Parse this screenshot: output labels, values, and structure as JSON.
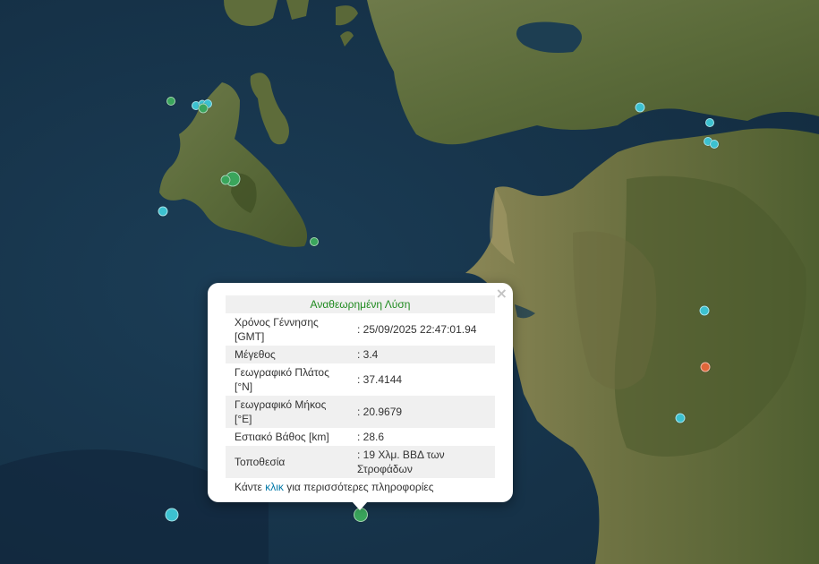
{
  "map": {
    "markers": [
      {
        "id": "m1",
        "color": "#3aa55c",
        "size": 10
      },
      {
        "id": "m2",
        "color": "#3cc1d0",
        "size": 10
      },
      {
        "id": "m3",
        "color": "#3cc1d0",
        "size": 9
      },
      {
        "id": "m4",
        "color": "#3cc1d0",
        "size": 10
      },
      {
        "id": "m5",
        "color": "#3aa55c",
        "size": 11
      },
      {
        "id": "m6",
        "color": "#3aa55c",
        "size": 17
      },
      {
        "id": "m7",
        "color": "#3aa55c",
        "size": 11
      },
      {
        "id": "m8",
        "color": "#3cc1d0",
        "size": 11
      },
      {
        "id": "m9",
        "color": "#3aa55c",
        "size": 10
      },
      {
        "id": "m10",
        "color": "#3cc1d0",
        "size": 11
      },
      {
        "id": "m11",
        "color": "#3cc1d0",
        "size": 10
      },
      {
        "id": "m12",
        "color": "#3cc1d0",
        "size": 10
      },
      {
        "id": "m13",
        "color": "#3cc1d0",
        "size": 10
      },
      {
        "id": "m14",
        "color": "#3cc1d0",
        "size": 11
      },
      {
        "id": "m15",
        "color": "#e0663a",
        "size": 11
      },
      {
        "id": "m16",
        "color": "#3cc1d0",
        "size": 11
      },
      {
        "id": "m17",
        "color": "#3cc1d0",
        "size": 15
      },
      {
        "id": "m18",
        "color": "#3aa55c",
        "size": 16
      }
    ]
  },
  "popup": {
    "close_symbol": "×",
    "title": "Αναθεωρημένη Λύση",
    "rows": [
      {
        "label": "Χρόνος Γέννησης [GMT]",
        "value": ": 25/09/2025 22:47:01.94"
      },
      {
        "label": "Μέγεθος",
        "value": ": 3.4"
      },
      {
        "label": "Γεωγραφικό Πλάτος [°N]",
        "value": ": 37.4144"
      },
      {
        "label": "Γεωγραφικό Μήκος [°E]",
        "value": ": 20.9679"
      },
      {
        "label": "Εστιακό Βάθος [km]",
        "value": ": 28.6"
      },
      {
        "label": "Τοποθεσία",
        "value": ": 19 Χλμ. ΒΒΔ των Στροφάδων"
      }
    ],
    "footer_prefix": "Κάντε ",
    "footer_link": "κλικ",
    "footer_suffix": " για περισσότερες πληροφορίες"
  }
}
